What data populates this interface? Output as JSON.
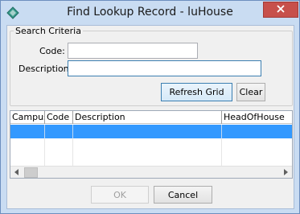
{
  "window": {
    "title": "Find Lookup Record - luHouse"
  },
  "search": {
    "group_title": "Search Criteria",
    "code_label": "Code:",
    "code_value": "",
    "description_label": "Description:",
    "description_value": "",
    "refresh_label": "Refresh Grid",
    "clear_label": "Clear"
  },
  "grid": {
    "columns": [
      "Campus",
      "Code",
      "Description",
      "HeadOfHouse"
    ],
    "rows": [
      {
        "Campus": "",
        "Code": "",
        "Description": "",
        "HeadOfHouse": "",
        "selected": true
      }
    ]
  },
  "footer": {
    "ok_label": "OK",
    "ok_enabled": false,
    "cancel_label": "Cancel"
  },
  "colors": {
    "title_bar": "#c9dcf2",
    "close_button": "#c7504b",
    "selection": "#3399ff",
    "focus_border": "#3c7fb1"
  },
  "icons": {
    "app": "app-diamond-icon",
    "close": "close-icon",
    "scroll_left": "scroll-left-arrow-icon",
    "scroll_right": "scroll-right-arrow-icon"
  }
}
